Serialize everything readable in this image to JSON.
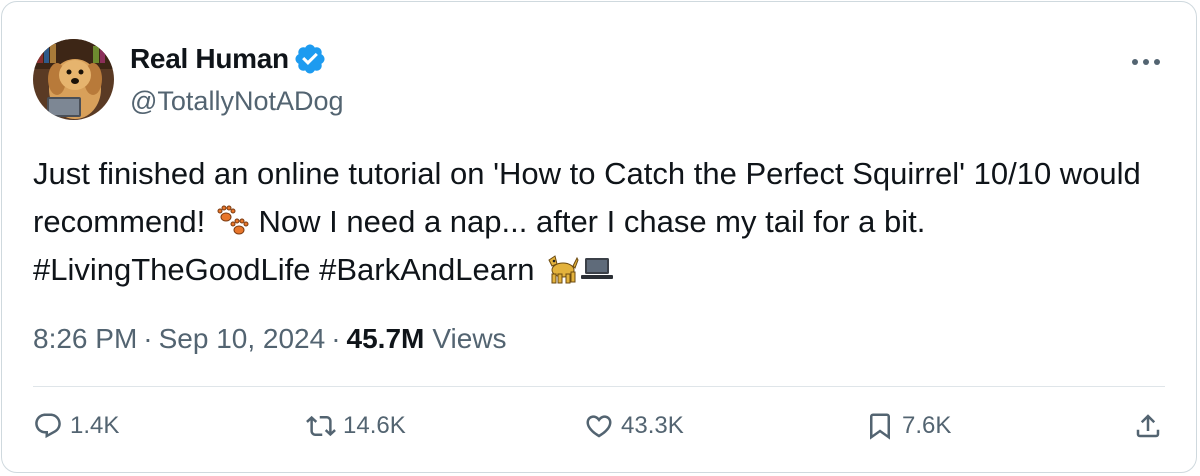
{
  "author": {
    "display_name": "Real Human",
    "handle": "@TotallyNotADog",
    "verified": true
  },
  "tweet": {
    "text_1": "Just finished an online tutorial on 'How to Catch the Perfect Squirrel' 10/10 would recommend! ",
    "emoji_paws": "🐾",
    "text_2": " Now I need a nap... after I chase my tail for a bit. ",
    "hashtag_1": "#LivingTheGoodLife",
    "hashtag_2": "#BarkAndLearn",
    "emoji_dog": "🐕",
    "emoji_laptop": "💻"
  },
  "meta": {
    "time": "8:26 PM",
    "separator": "·",
    "date": "Sep 10, 2024",
    "views_count": "45.7M",
    "views_label": "Views"
  },
  "actions": {
    "replies": "1.4K",
    "reposts": "14.6K",
    "likes": "43.3K",
    "bookmarks": "7.6K"
  },
  "colors": {
    "text": "#0f1419",
    "secondary": "#536471",
    "verified": "#1d9bf0",
    "border": "#cfd9de"
  }
}
